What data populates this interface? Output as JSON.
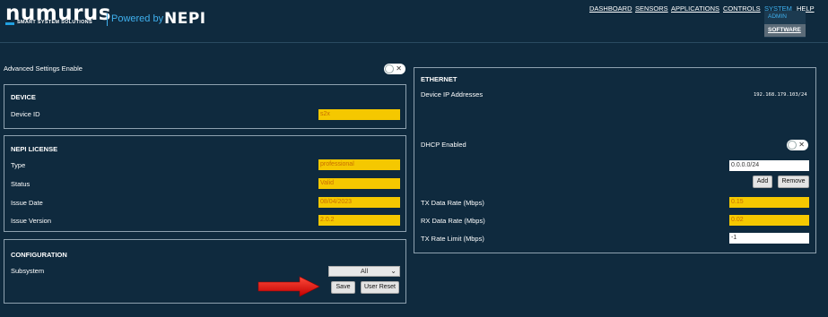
{
  "header": {
    "logo_text": "numurus",
    "logo_subtext": "SMART SYSTEM SOLUTIONS",
    "powered_label": "Powered by",
    "powered_brand": "NEPI",
    "nav": [
      "DASHBOARD",
      "SENSORS",
      "APPLICATIONS",
      "CONTROLS",
      "SYSTEM",
      "HELP"
    ],
    "active_nav": "SYSTEM",
    "submenu": [
      "ADMIN",
      "SOFTWARE"
    ]
  },
  "advanced": {
    "label": "Advanced Settings Enable",
    "toggle_x": "✕"
  },
  "device": {
    "title": "DEVICE",
    "id_label": "Device ID",
    "id_value": "s2x"
  },
  "license": {
    "title": "NEPI LICENSE",
    "rows": [
      {
        "label": "Type",
        "value": "professional"
      },
      {
        "label": "Status",
        "value": "Valid"
      },
      {
        "label": "Issue Date",
        "value": "08/04/2023"
      },
      {
        "label": "Issue Version",
        "value": "2.0.2"
      }
    ]
  },
  "configuration": {
    "title": "CONFIGURATION",
    "subsystem_label": "Subsystem",
    "subsystem_value": "All",
    "save_label": "Save",
    "user_reset_label": "User Reset"
  },
  "ethernet": {
    "title": "ETHERNET",
    "ip_label": "Device IP Addresses",
    "ip_value": "192.168.179.103/24",
    "dhcp_label": "DHCP Enabled",
    "dhcp_toggle_x": "✕",
    "new_ip_value": "0.0.0.0/24",
    "add_label": "Add",
    "remove_label": "Remove",
    "tx_rate_label": "TX Data Rate (Mbps)",
    "tx_rate_value": "0.15",
    "rx_rate_label": "RX Data Rate (Mbps)",
    "rx_rate_value": "0.02",
    "tx_limit_label": "TX Rate Limit (Mbps)",
    "tx_limit_value": "-1"
  },
  "colors": {
    "background": "#0f2a3e",
    "accent": "#3fb0ee",
    "field_yellow": "#f5c800",
    "arrow_red": "#e01010"
  }
}
